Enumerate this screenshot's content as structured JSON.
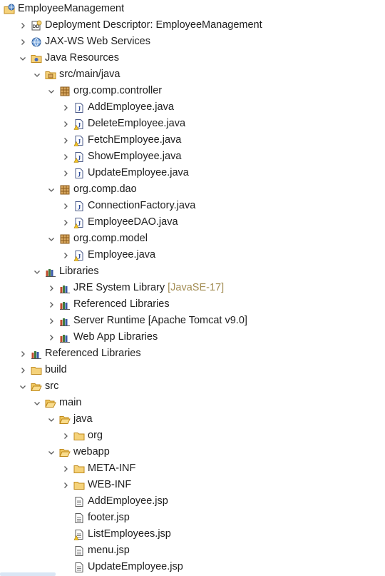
{
  "tree": [
    {
      "label": "EmployeeManagement",
      "icon": "web-project-icon",
      "twisty": "none",
      "depth": 0
    },
    {
      "label": "Deployment Descriptor: EmployeeManagement",
      "icon": "deployment-descriptor-icon",
      "twisty": "collapsed",
      "depth": 1
    },
    {
      "label": "JAX-WS Web Services",
      "icon": "web-services-icon",
      "twisty": "collapsed",
      "depth": 1
    },
    {
      "label": "Java Resources",
      "icon": "java-resources-icon",
      "twisty": "expanded",
      "depth": 1
    },
    {
      "label": "src/main/java",
      "icon": "source-folder-icon",
      "twisty": "expanded",
      "depth": 2
    },
    {
      "label": "org.comp.controller",
      "icon": "package-icon",
      "twisty": "expanded",
      "depth": 3
    },
    {
      "label": "AddEmployee.java",
      "icon": "java-file-icon",
      "twisty": "collapsed",
      "depth": 4
    },
    {
      "label": "DeleteEmployee.java",
      "icon": "java-file-warning-icon",
      "twisty": "collapsed",
      "depth": 4
    },
    {
      "label": "FetchEmployee.java",
      "icon": "java-file-warning-icon",
      "twisty": "collapsed",
      "depth": 4
    },
    {
      "label": "ShowEmployee.java",
      "icon": "java-file-warning-icon",
      "twisty": "collapsed",
      "depth": 4
    },
    {
      "label": "UpdateEmployee.java",
      "icon": "java-file-icon",
      "twisty": "collapsed",
      "depth": 4
    },
    {
      "label": "org.comp.dao",
      "icon": "package-icon",
      "twisty": "expanded",
      "depth": 3
    },
    {
      "label": "ConnectionFactory.java",
      "icon": "java-file-icon",
      "twisty": "collapsed",
      "depth": 4
    },
    {
      "label": "EmployeeDAO.java",
      "icon": "java-file-warning-icon",
      "twisty": "collapsed",
      "depth": 4
    },
    {
      "label": "org.comp.model",
      "icon": "package-icon",
      "twisty": "expanded",
      "depth": 3
    },
    {
      "label": "Employee.java",
      "icon": "java-file-warning-icon",
      "twisty": "collapsed",
      "depth": 4
    },
    {
      "label": "Libraries",
      "icon": "library-icon",
      "twisty": "expanded",
      "depth": 2
    },
    {
      "label": "JRE System Library",
      "icon": "library-icon",
      "twisty": "collapsed",
      "depth": 3,
      "decoration": "[JavaSE-17]"
    },
    {
      "label": "Referenced Libraries",
      "icon": "library-icon",
      "twisty": "collapsed",
      "depth": 3
    },
    {
      "label": "Server Runtime [Apache Tomcat v9.0]",
      "icon": "library-icon",
      "twisty": "collapsed",
      "depth": 3
    },
    {
      "label": "Web App Libraries",
      "icon": "library-icon",
      "twisty": "collapsed",
      "depth": 3
    },
    {
      "label": "Referenced Libraries",
      "icon": "library-icon",
      "twisty": "collapsed",
      "depth": 1
    },
    {
      "label": "build",
      "icon": "folder-icon",
      "twisty": "collapsed",
      "depth": 1
    },
    {
      "label": "src",
      "icon": "folder-open-icon",
      "twisty": "expanded",
      "depth": 1
    },
    {
      "label": "main",
      "icon": "folder-open-icon",
      "twisty": "expanded",
      "depth": 2
    },
    {
      "label": "java",
      "icon": "folder-open-icon",
      "twisty": "expanded",
      "depth": 3
    },
    {
      "label": "org",
      "icon": "folder-icon",
      "twisty": "collapsed",
      "depth": 4
    },
    {
      "label": "webapp",
      "icon": "folder-open-icon",
      "twisty": "expanded",
      "depth": 3
    },
    {
      "label": "META-INF",
      "icon": "folder-icon",
      "twisty": "collapsed",
      "depth": 4
    },
    {
      "label": "WEB-INF",
      "icon": "folder-icon",
      "twisty": "collapsed",
      "depth": 4
    },
    {
      "label": "AddEmployee.jsp",
      "icon": "jsp-file-icon",
      "twisty": "none",
      "depth": 4
    },
    {
      "label": "footer.jsp",
      "icon": "jsp-file-icon",
      "twisty": "none",
      "depth": 4
    },
    {
      "label": "ListEmployees.jsp",
      "icon": "jsp-file-warning-icon",
      "twisty": "none",
      "depth": 4
    },
    {
      "label": "menu.jsp",
      "icon": "jsp-file-icon",
      "twisty": "none",
      "depth": 4
    },
    {
      "label": "UpdateEmployee.jsp",
      "icon": "jsp-file-icon",
      "twisty": "none",
      "depth": 4
    }
  ]
}
